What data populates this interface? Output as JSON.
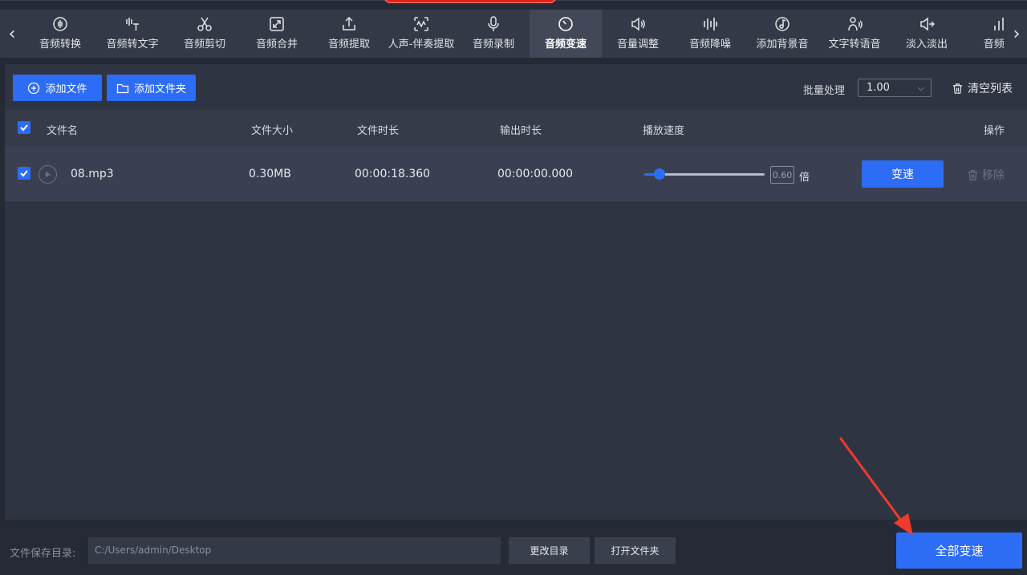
{
  "toolbar": {
    "prev_arrow": "‹",
    "next_arrow": "›",
    "items": [
      {
        "label": "音频转换",
        "icon": "audio-convert-icon",
        "active": false
      },
      {
        "label": "音频转文字",
        "icon": "audio-to-text-icon",
        "active": false
      },
      {
        "label": "音频剪切",
        "icon": "scissors-icon",
        "active": false
      },
      {
        "label": "音频合并",
        "icon": "merge-icon",
        "active": false
      },
      {
        "label": "音频提取",
        "icon": "extract-icon",
        "active": false
      },
      {
        "label": "人声-伴奏提取",
        "icon": "voice-separate-icon",
        "active": false
      },
      {
        "label": "音频录制",
        "icon": "microphone-icon",
        "active": false
      },
      {
        "label": "音频变速",
        "icon": "speed-icon",
        "active": true
      },
      {
        "label": "音量调整",
        "icon": "volume-icon",
        "active": false
      },
      {
        "label": "音频降噪",
        "icon": "denoise-icon",
        "active": false
      },
      {
        "label": "添加背景音",
        "icon": "background-music-icon",
        "active": false
      },
      {
        "label": "文字转语音",
        "icon": "text-to-speech-icon",
        "active": false
      },
      {
        "label": "淡入淡出",
        "icon": "fade-icon",
        "active": false
      },
      {
        "label": "音频...",
        "icon": "audio-bars-icon",
        "active": false
      }
    ]
  },
  "actions": {
    "add_file": "添加文件",
    "add_folder": "添加文件夹",
    "batch_label": "批量处理",
    "batch_value": "1.00",
    "clear_list": "清空列表"
  },
  "table": {
    "columns": {
      "name": "文件名",
      "size": "文件大小",
      "duration": "文件时长",
      "output_duration": "输出时长",
      "speed": "播放速度",
      "operation": "操作"
    },
    "rows": [
      {
        "checked": true,
        "name": "08.mp3",
        "size": "0.30MB",
        "duration": "00:00:18.360",
        "output_duration": "00:00:00.000",
        "speed_value": "0.60",
        "speed_fraction": 0.1,
        "speed_unit": "倍",
        "action": "变速",
        "remove": "移除"
      }
    ]
  },
  "footer": {
    "save_label": "文件保存目录:",
    "save_path": "C:/Users/admin/Desktop",
    "change_dir": "更改目录",
    "open_folder": "打开文件夹",
    "convert_all": "全部变速"
  },
  "colors": {
    "accent": "#2d6cf5",
    "annotation_arrow": "#f03a2e"
  }
}
